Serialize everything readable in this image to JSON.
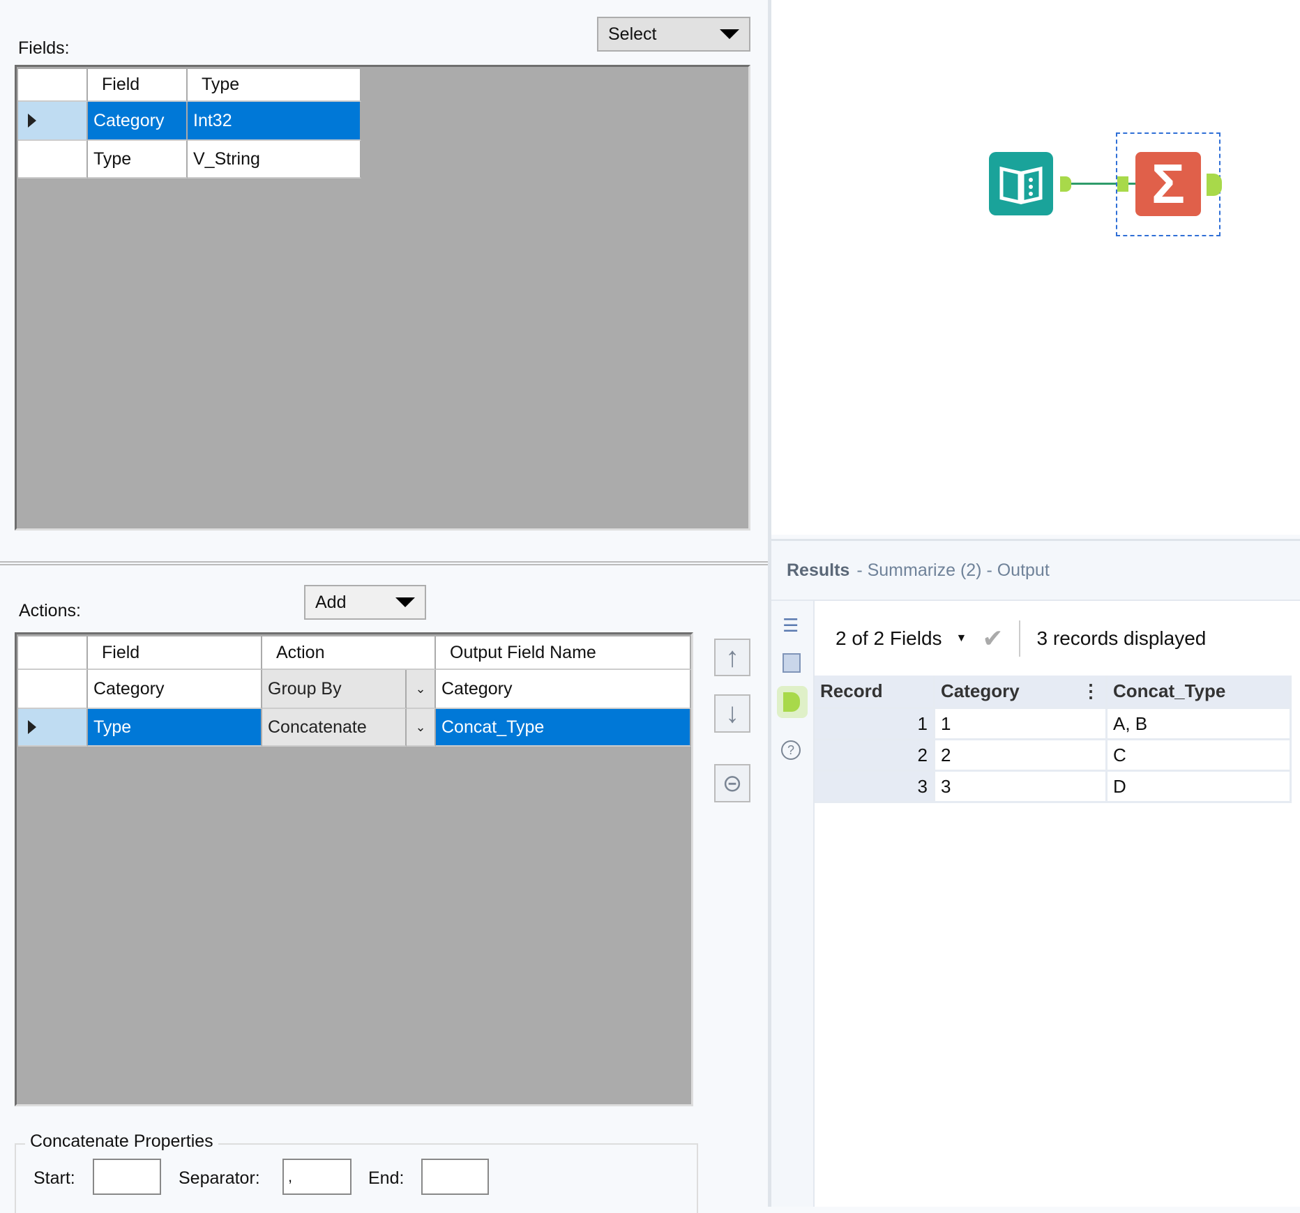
{
  "fields_panel": {
    "label": "Fields:",
    "select_button": "Select",
    "columns": [
      "Field",
      "Type"
    ],
    "rows": [
      {
        "field": "Category",
        "type": "Int32",
        "selected": true
      },
      {
        "field": "Type",
        "type": "V_String",
        "selected": false
      }
    ]
  },
  "actions_panel": {
    "label": "Actions:",
    "add_button": "Add",
    "columns": [
      "Field",
      "Action",
      "Output Field Name"
    ],
    "rows": [
      {
        "field": "Category",
        "action": "Group By",
        "output": "Category",
        "selected": false
      },
      {
        "field": "Type",
        "action": "Concatenate",
        "output": "Concat_Type",
        "selected": true
      }
    ]
  },
  "concat_props": {
    "title": "Concatenate Properties",
    "start_label": "Start:",
    "start_value": "",
    "separator_label": "Separator:",
    "separator_value": ",",
    "end_label": "End:",
    "end_value": ""
  },
  "results": {
    "title": "Results",
    "subtitle": "- Summarize (2) - Output",
    "fields_selector": "2 of 2 Fields",
    "records_text": "3 records displayed",
    "columns": [
      "Record",
      "Category",
      "Concat_Type"
    ],
    "rows": [
      {
        "record": "1",
        "category": "1",
        "concat": "A, B"
      },
      {
        "record": "2",
        "category": "2",
        "concat": "C"
      },
      {
        "record": "3",
        "category": "3",
        "concat": "D"
      }
    ]
  },
  "colors": {
    "selection": "#0078d7",
    "input_tool": "#1aa39a",
    "summarize_tool": "#e0604a",
    "anchor": "#a8d94a"
  }
}
